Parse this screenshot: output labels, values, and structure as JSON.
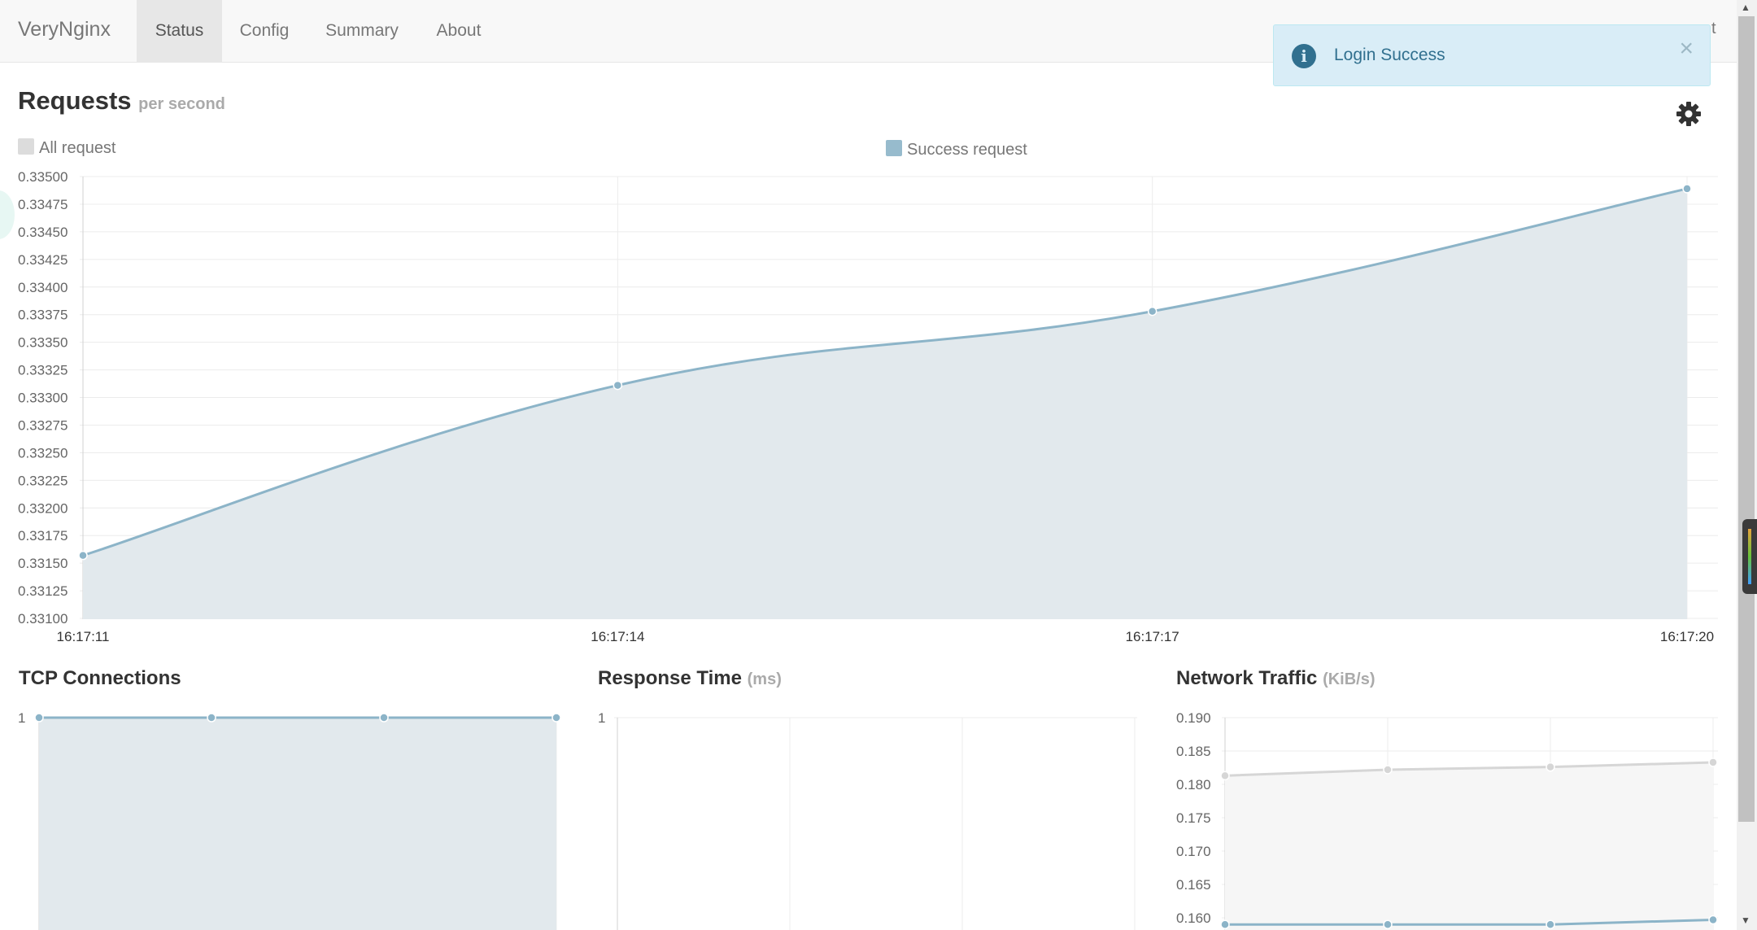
{
  "navbar": {
    "brand": "VeryNginx",
    "items": [
      {
        "label": "Status",
        "active": true
      },
      {
        "label": "Config",
        "active": false
      },
      {
        "label": "Summary",
        "active": false
      },
      {
        "label": "About",
        "active": false
      }
    ],
    "right_text": "t"
  },
  "alert": {
    "message": "Login Success",
    "icon": "info-circle-icon",
    "close": "×"
  },
  "colors": {
    "series_blue": "#8cb4c8",
    "series_fill": "#e2e9ed",
    "grey_series": "#d6d6d6",
    "alert_bg": "#d9edf7",
    "alert_text": "#31708f"
  },
  "requests": {
    "title": "Requests",
    "subtitle": "per second",
    "legend": [
      {
        "label": "All request",
        "color": "#dcdcdc"
      },
      {
        "label": "Success request",
        "color": "#97bbcd"
      }
    ]
  },
  "tcp": {
    "title": "TCP Connections",
    "subtitle": ""
  },
  "response": {
    "title": "Response Time",
    "subtitle": "(ms)"
  },
  "traffic": {
    "title": "Network Traffic",
    "subtitle": "(KiB/s)"
  },
  "chart_data": [
    {
      "id": "requests",
      "type": "area",
      "x": [
        "16:17:11",
        "16:17:14",
        "16:17:17",
        "16:17:20"
      ],
      "series": [
        {
          "name": "Success request",
          "values": [
            0.33157,
            0.33311,
            0.33378,
            0.33489
          ]
        }
      ],
      "ylim": [
        0.331,
        0.335
      ],
      "yticks": [
        "0.33500",
        "0.33475",
        "0.33450",
        "0.33425",
        "0.33400",
        "0.33375",
        "0.33350",
        "0.33325",
        "0.33300",
        "0.33275",
        "0.33250",
        "0.33225",
        "0.33200",
        "0.33175",
        "0.33150",
        "0.33125",
        "0.33100"
      ],
      "grid": true
    },
    {
      "id": "tcp",
      "type": "area",
      "x": [
        "",
        "",
        "",
        ""
      ],
      "series": [
        {
          "values": [
            1,
            1,
            1,
            1
          ]
        }
      ],
      "yticks": [
        "1"
      ],
      "grid": true
    },
    {
      "id": "response",
      "type": "line",
      "x": [
        "",
        "",
        "",
        ""
      ],
      "series": [],
      "yticks": [
        "1"
      ],
      "grid": true
    },
    {
      "id": "traffic",
      "type": "line",
      "x": [
        "",
        "",
        "",
        ""
      ],
      "series": [
        {
          "values": [
            0.1813,
            0.1822,
            0.1826,
            0.1833
          ]
        },
        {
          "values": [
            0.159,
            0.159,
            0.159,
            0.1597
          ]
        }
      ],
      "ylim": [
        0.16,
        0.19
      ],
      "yticks": [
        "0.190",
        "0.185",
        "0.180",
        "0.175",
        "0.170",
        "0.165",
        "0.160"
      ],
      "grid": true
    }
  ]
}
